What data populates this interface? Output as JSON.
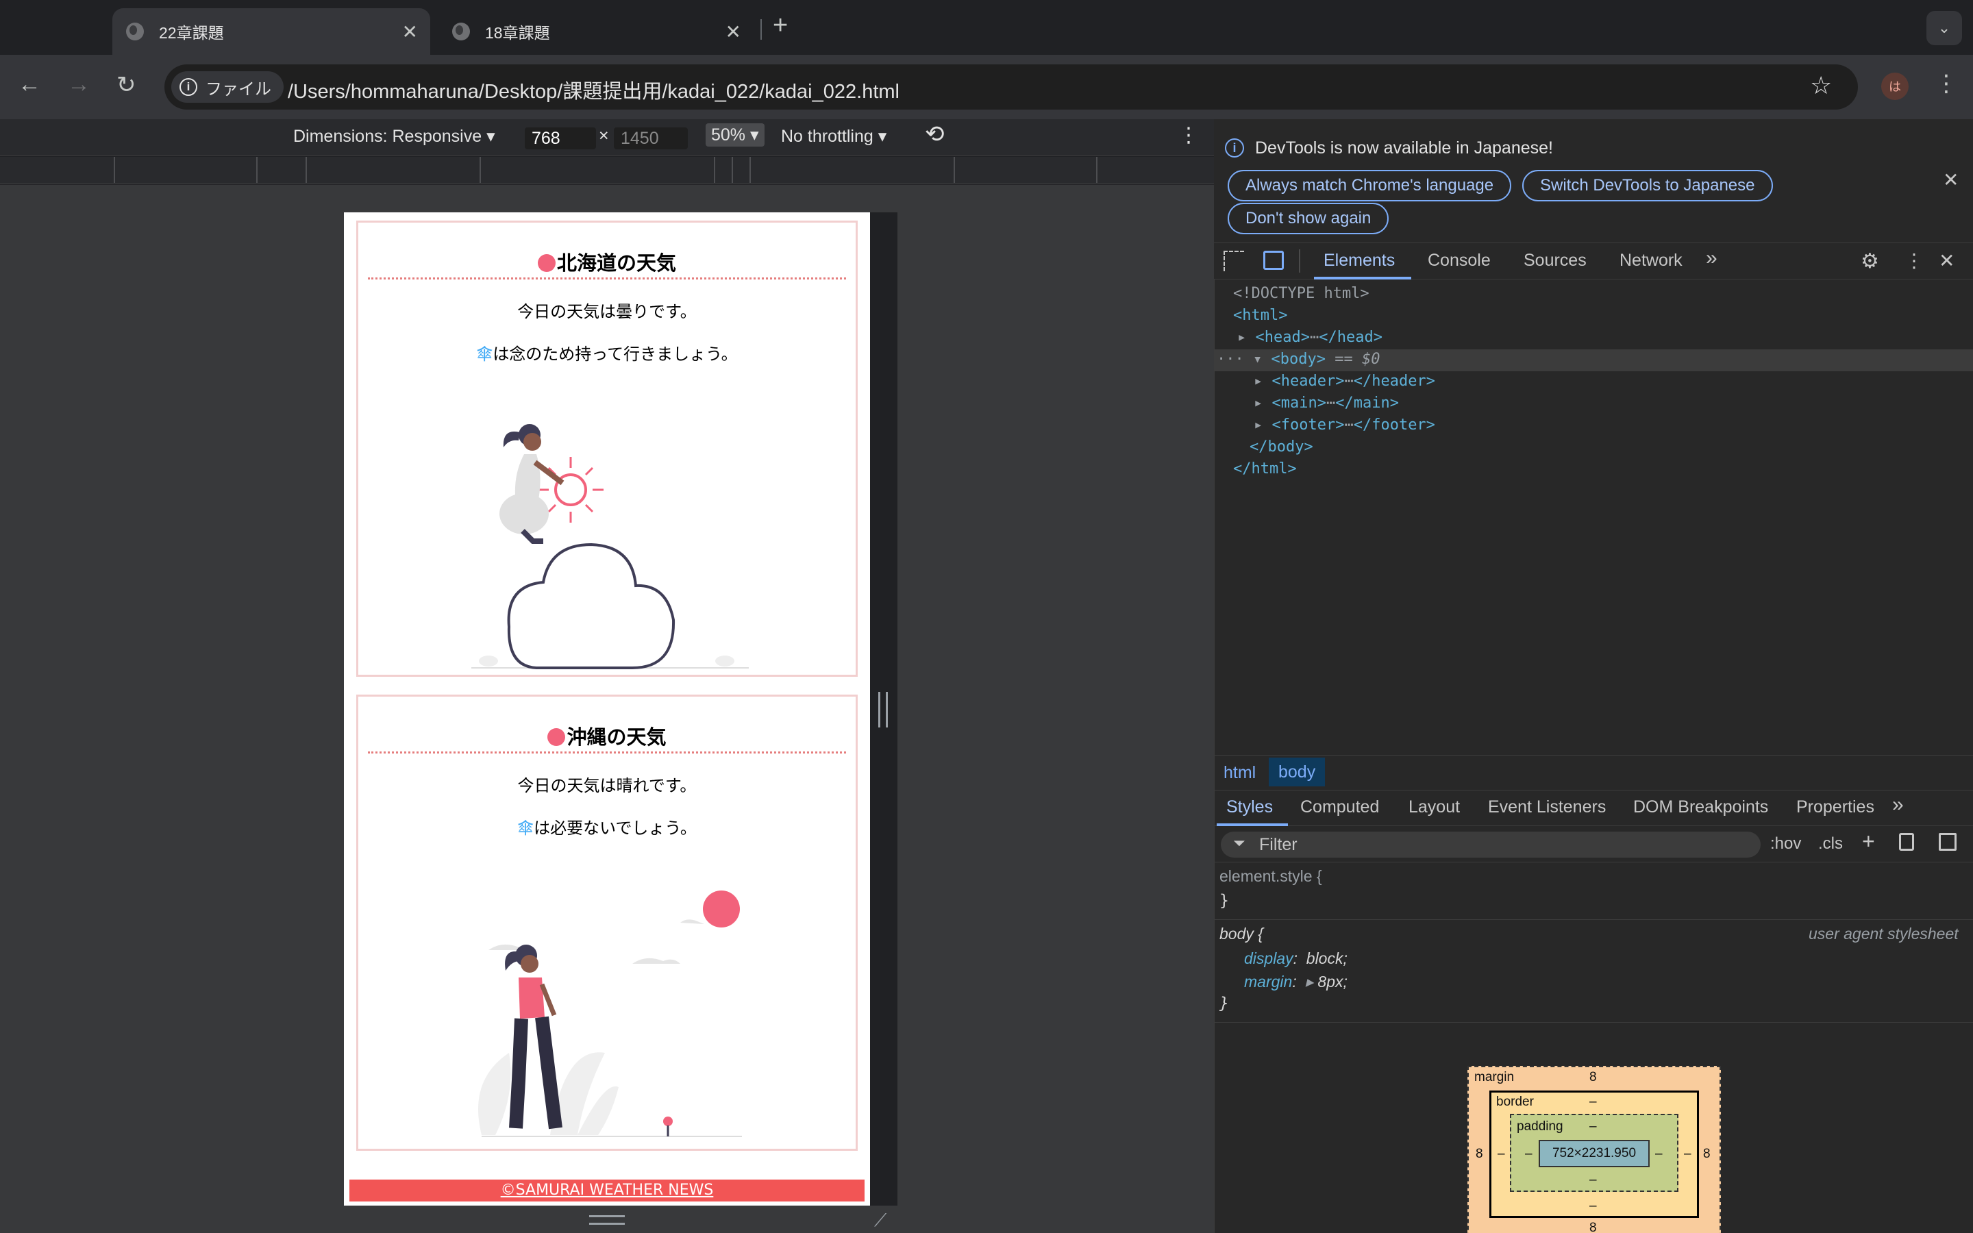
{
  "browser": {
    "tabs": [
      {
        "title": "22章課題",
        "close": "✕"
      },
      {
        "title": "18章課題",
        "close": "✕"
      }
    ],
    "new_tab": "+",
    "tab_menu": "⌄",
    "nav": {
      "back": "←",
      "forward": "→",
      "reload": "↻"
    },
    "security_chip": {
      "icon": "i",
      "label": "ファイル"
    },
    "url": "/Users/hommaharuna/Desktop/課題提出用/kadai_022/kadai_022.html",
    "bookmark_star": "☆",
    "profile_initial": "は",
    "menu": "⋮"
  },
  "device_toolbar": {
    "dimensions": "Dimensions: Responsive ▾",
    "width": "768",
    "times": "×",
    "height": "1450",
    "zoom": "50% ▾",
    "throttling": "No throttling ▾",
    "rotate_icon": "⟲",
    "more": "⋮"
  },
  "page": {
    "cards": [
      {
        "title": "北海道の天気",
        "line1": "今日の天気は曇りです。",
        "umbrella": "傘",
        "line2": "は念のため持って行きましょう。"
      },
      {
        "title": "沖縄の天気",
        "line1": "今日の天気は晴れです。",
        "umbrella": "傘",
        "line2": "は必要ないでしょう。"
      }
    ],
    "footer": "©SAMURAI WEATHER NEWS",
    "colors": {
      "accent": "#f2627b",
      "footer": "#f25555",
      "card_border": "#f2cfcf",
      "umbrella": "#3fa9f5"
    }
  },
  "devtools": {
    "info_message": "DevTools is now available in Japanese!",
    "buttons": [
      "Always match Chrome's language",
      "Switch DevTools to Japanese",
      "Don't show again"
    ],
    "close": "✕",
    "tabs": [
      "Elements",
      "Console",
      "Sources",
      "Network"
    ],
    "more_tabs": "»",
    "dom": {
      "doctype": "<!DOCTYPE html>",
      "html_open": "<html>",
      "head": "<head>",
      "head_close": "</head>",
      "body": "<body>",
      "body_marker": "== $0",
      "header": "<header>",
      "header_close": "</header>",
      "main": "<main>",
      "main_close": "</main>",
      "footer": "<footer>",
      "footer_close": "</footer>",
      "body_close": "</body>",
      "html_close": "</html>",
      "ellipsis": "⋯"
    },
    "breadcrumbs": [
      "html",
      "body"
    ],
    "styles_tabs": [
      "Styles",
      "Computed",
      "Layout",
      "Event Listeners",
      "DOM Breakpoints",
      "Properties"
    ],
    "filter_placeholder": "Filter",
    "hov": ":hov",
    "cls": ".cls",
    "styles": {
      "element_style": "element.style {",
      "brace_close": "}",
      "body_selector": "body {",
      "source": "user agent stylesheet",
      "display_prop": "display",
      "display_val": "block;",
      "margin_prop": "margin",
      "margin_val": "8px;"
    },
    "box_model": {
      "margin_label": "margin",
      "margin": "8",
      "border_label": "border",
      "border": "–",
      "padding_label": "padding",
      "padding": "–",
      "content": "752×2231.950"
    }
  }
}
